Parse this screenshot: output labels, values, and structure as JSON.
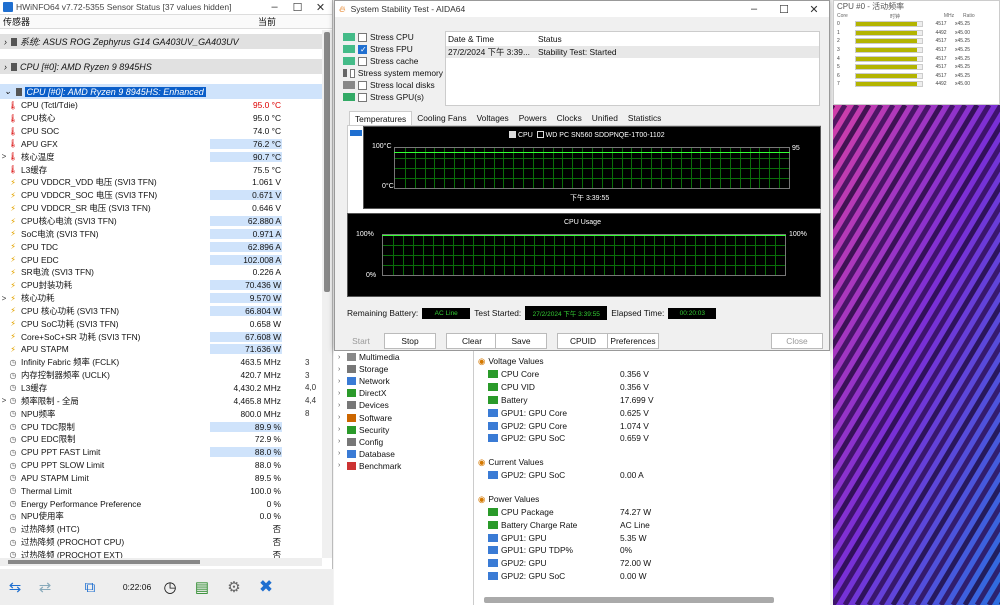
{
  "hwinfo": {
    "title": "HWiNFO64 v7.72-5355 Sensor Status [37 values hidden]",
    "col_sensor": "传感器",
    "col_current": "当前",
    "groups": [
      {
        "label": "系统: ASUS ROG Zephyrus G14 GA403UV_GA403UV"
      },
      {
        "label": "CPU [#0]: AMD Ryzen 9 8945HS"
      },
      {
        "label": "CPU [#0]: AMD Ryzen 9 8945HS: Enhanced"
      }
    ],
    "rows": [
      {
        "expand": "",
        "icon": "thermometer-icon",
        "label": "CPU (Tctl/Tdie)",
        "value": "95.0 °C",
        "hl": false,
        "red": true,
        "v2": ""
      },
      {
        "expand": "",
        "icon": "thermometer-icon",
        "label": "CPU核心",
        "value": "95.0 °C",
        "hl": false,
        "red": false,
        "v2": ""
      },
      {
        "expand": "",
        "icon": "thermometer-icon",
        "label": "CPU SOC",
        "value": "74.0 °C",
        "hl": false,
        "red": false,
        "v2": ""
      },
      {
        "expand": "",
        "icon": "thermometer-icon",
        "label": "APU GFX",
        "value": "76.2 °C",
        "hl": true,
        "red": false,
        "v2": ""
      },
      {
        "expand": ">",
        "icon": "thermometer-icon",
        "label": "核心温度",
        "value": "90.7 °C",
        "hl": true,
        "red": false,
        "v2": ""
      },
      {
        "expand": "",
        "icon": "thermometer-icon",
        "label": "L3缓存",
        "value": "75.5 °C",
        "hl": false,
        "red": false,
        "v2": ""
      },
      {
        "expand": "",
        "icon": "voltage-icon",
        "label": "CPU VDDCR_VDD 电压 (SVI3 TFN)",
        "value": "1.061 V",
        "hl": false,
        "red": false,
        "v2": ""
      },
      {
        "expand": "",
        "icon": "voltage-icon",
        "label": "CPU VDDCR_SOC 电压 (SVI3 TFN)",
        "value": "0.671 V",
        "hl": true,
        "red": false,
        "v2": ""
      },
      {
        "expand": "",
        "icon": "voltage-icon",
        "label": "CPU VDDCR_SR 电压 (SVI3 TFN)",
        "value": "0.646 V",
        "hl": false,
        "red": false,
        "v2": ""
      },
      {
        "expand": "",
        "icon": "current-icon",
        "label": "CPU核心电流 (SVI3 TFN)",
        "value": "62.880 A",
        "hl": true,
        "red": false,
        "v2": ""
      },
      {
        "expand": "",
        "icon": "current-icon",
        "label": "SoC电流 (SVI3 TFN)",
        "value": "0.971 A",
        "hl": true,
        "red": false,
        "v2": ""
      },
      {
        "expand": "",
        "icon": "current-icon",
        "label": "CPU TDC",
        "value": "62.896 A",
        "hl": true,
        "red": false,
        "v2": ""
      },
      {
        "expand": "",
        "icon": "current-icon",
        "label": "CPU EDC",
        "value": "102.008 A",
        "hl": true,
        "red": false,
        "v2": ""
      },
      {
        "expand": "",
        "icon": "current-icon",
        "label": "SR电流 (SVI3 TFN)",
        "value": "0.226 A",
        "hl": false,
        "red": false,
        "v2": ""
      },
      {
        "expand": "",
        "icon": "power-icon",
        "label": "CPU封装功耗",
        "value": "70.436 W",
        "hl": true,
        "red": false,
        "v2": ""
      },
      {
        "expand": ">",
        "icon": "power-icon",
        "label": "核心功耗",
        "value": "9.570 W",
        "hl": true,
        "red": false,
        "v2": ""
      },
      {
        "expand": "",
        "icon": "power-icon",
        "label": "CPU 核心功耗 (SVI3 TFN)",
        "value": "66.804 W",
        "hl": true,
        "red": false,
        "v2": ""
      },
      {
        "expand": "",
        "icon": "power-icon",
        "label": "CPU SoC功耗 (SVI3 TFN)",
        "value": "0.658 W",
        "hl": false,
        "red": false,
        "v2": ""
      },
      {
        "expand": "",
        "icon": "power-icon",
        "label": "Core+SoC+SR 功耗 (SVI3 TFN)",
        "value": "67.608 W",
        "hl": true,
        "red": false,
        "v2": ""
      },
      {
        "expand": "",
        "icon": "power-icon",
        "label": "APU STAPM",
        "value": "71.636 W",
        "hl": true,
        "red": false,
        "v2": ""
      },
      {
        "expand": "",
        "icon": "clock-icon",
        "label": "Infinity Fabric 频率 (FCLK)",
        "value": "463.5 MHz",
        "hl": false,
        "red": false,
        "v2": "3"
      },
      {
        "expand": "",
        "icon": "clock-icon",
        "label": "内存控制器频率 (UCLK)",
        "value": "420.7 MHz",
        "hl": false,
        "red": false,
        "v2": "3"
      },
      {
        "expand": "",
        "icon": "clock-icon",
        "label": "L3缓存",
        "value": "4,430.2 MHz",
        "hl": false,
        "red": false,
        "v2": "4,0"
      },
      {
        "expand": ">",
        "icon": "clock-icon",
        "label": "频率限制 - 全局",
        "value": "4,465.8 MHz",
        "hl": false,
        "red": false,
        "v2": "4,4"
      },
      {
        "expand": "",
        "icon": "clock-icon",
        "label": "NPU频率",
        "value": "800.0 MHz",
        "hl": false,
        "red": false,
        "v2": "8"
      },
      {
        "expand": "",
        "icon": "clock-icon",
        "label": "CPU TDC限制",
        "value": "89.9 %",
        "hl": true,
        "red": false,
        "v2": ""
      },
      {
        "expand": "",
        "icon": "clock-icon",
        "label": "CPU EDC限制",
        "value": "72.9 %",
        "hl": false,
        "red": false,
        "v2": ""
      },
      {
        "expand": "",
        "icon": "clock-icon",
        "label": "CPU PPT FAST Limit",
        "value": "88.0 %",
        "hl": true,
        "red": false,
        "v2": ""
      },
      {
        "expand": "",
        "icon": "clock-icon",
        "label": "CPU PPT SLOW Limit",
        "value": "88.0 %",
        "hl": false,
        "red": false,
        "v2": ""
      },
      {
        "expand": "",
        "icon": "clock-icon",
        "label": "APU STAPM Limit",
        "value": "89.5 %",
        "hl": false,
        "red": false,
        "v2": ""
      },
      {
        "expand": "",
        "icon": "clock-icon",
        "label": "Thermal Limit",
        "value": "100.0 %",
        "hl": false,
        "red": false,
        "v2": ""
      },
      {
        "expand": "",
        "icon": "clock-icon",
        "label": "Energy Performance Preference",
        "value": "0 %",
        "hl": false,
        "red": false,
        "v2": ""
      },
      {
        "expand": "",
        "icon": "clock-icon",
        "label": "NPU使用率",
        "value": "0.0 %",
        "hl": false,
        "red": false,
        "v2": ""
      },
      {
        "expand": "",
        "icon": "clock-icon",
        "label": "过热降频 (HTC)",
        "value": "否",
        "hl": false,
        "red": false,
        "v2": ""
      },
      {
        "expand": "",
        "icon": "clock-icon",
        "label": "过热降频 (PROCHOT CPU)",
        "value": "否",
        "hl": false,
        "red": false,
        "v2": ""
      },
      {
        "expand": "",
        "icon": "clock-icon",
        "label": "过热降频 (PROCHOT EXT)",
        "value": "否",
        "hl": false,
        "red": false,
        "v2": ""
      }
    ],
    "elapsed": "0:22:06"
  },
  "aida": {
    "title": "System Stability Test - AIDA64",
    "stress_items": [
      {
        "label": "Stress CPU",
        "checked": false,
        "icon": "cpu-chip-icon"
      },
      {
        "label": "Stress FPU",
        "checked": true,
        "icon": "fpu-chip-icon"
      },
      {
        "label": "Stress cache",
        "checked": false,
        "icon": "cache-chip-icon"
      },
      {
        "label": "Stress system memory",
        "checked": false,
        "icon": "memory-icon"
      },
      {
        "label": "Stress local disks",
        "checked": false,
        "icon": "disk-icon"
      },
      {
        "label": "Stress GPU(s)",
        "checked": false,
        "icon": "gpu-icon"
      }
    ],
    "log_headers": {
      "date": "Date & Time",
      "status": "Status"
    },
    "log_rows": [
      {
        "date": "27/2/2024 下午 3:39...",
        "status": "Stability Test: Started"
      }
    ],
    "tabs": [
      "Temperatures",
      "Cooling Fans",
      "Voltages",
      "Powers",
      "Clocks",
      "Unified",
      "Statistics"
    ],
    "temp_graph": {
      "legend_cpu": "CPU",
      "legend_disk": "WD PC SN560 SDDPNQE-1T00-1102",
      "y_top": "100°C",
      "y_bottom": "0°C",
      "value": "95",
      "time": "下午 3:39:55"
    },
    "cpu_graph": {
      "title": "CPU Usage",
      "y_top": "100%",
      "y_bottom": "0%",
      "value": "100%"
    },
    "status": {
      "remaining_label": "Remaining Battery:",
      "remaining_value": "AC Line",
      "started_label": "Test Started:",
      "started_value": "27/2/2024 下午 3:39:55",
      "elapsed_label": "Elapsed Time:",
      "elapsed_value": "00:20:03"
    },
    "buttons": {
      "start": "Start",
      "stop": "Stop",
      "clear": "Clear",
      "save": "Save",
      "cpuid": "CPUID",
      "prefs": "Preferences",
      "close": "Close"
    }
  },
  "aida_main": {
    "tree": [
      {
        "label": "Multimedia",
        "icon": "multimedia-icon"
      },
      {
        "label": "Storage",
        "icon": "storage-icon"
      },
      {
        "label": "Network",
        "icon": "network-icon"
      },
      {
        "label": "DirectX",
        "icon": "directx-icon"
      },
      {
        "label": "Devices",
        "icon": "devices-icon"
      },
      {
        "label": "Software",
        "icon": "software-icon"
      },
      {
        "label": "Security",
        "icon": "security-icon"
      },
      {
        "label": "Config",
        "icon": "config-icon"
      },
      {
        "label": "Database",
        "icon": "database-icon"
      },
      {
        "label": "Benchmark",
        "icon": "benchmark-icon"
      }
    ],
    "sections": [
      {
        "title": "Voltage Values",
        "rows": [
          {
            "label": "CPU Core",
            "value": "0.356 V",
            "icon": "cpu-icon"
          },
          {
            "label": "CPU VID",
            "value": "0.356 V",
            "icon": "cpu-icon"
          },
          {
            "label": "Battery",
            "value": "17.699 V",
            "icon": "battery-icon"
          },
          {
            "label": "GPU1: GPU Core",
            "value": "0.625 V",
            "icon": "gpu-icon"
          },
          {
            "label": "GPU2: GPU Core",
            "value": "1.074 V",
            "icon": "gpu-icon"
          },
          {
            "label": "GPU2: GPU SoC",
            "value": "0.659 V",
            "icon": "gpu-icon"
          }
        ]
      },
      {
        "title": "Current Values",
        "rows": [
          {
            "label": "GPU2: GPU SoC",
            "value": "0.00 A",
            "icon": "gpu-icon"
          }
        ]
      },
      {
        "title": "Power Values",
        "rows": [
          {
            "label": "CPU Package",
            "value": "74.27 W",
            "icon": "cpu-icon"
          },
          {
            "label": "Battery Charge Rate",
            "value": "AC Line",
            "icon": "battery-icon"
          },
          {
            "label": "GPU1: GPU",
            "value": "5.35 W",
            "icon": "gpu-icon"
          },
          {
            "label": "GPU1: GPU TDP%",
            "value": "0%",
            "icon": "gpu-icon"
          },
          {
            "label": "GPU2: GPU",
            "value": "72.00 W",
            "icon": "gpu-icon"
          },
          {
            "label": "GPU2: GPU SoC",
            "value": "0.00 W",
            "icon": "gpu-icon"
          }
        ]
      }
    ]
  },
  "cpu_monitor": {
    "title": "CPU #0 - 活动频率",
    "headers": {
      "core": "Core",
      "clock": "时钟",
      "mhz": "MHz",
      "ratio": "Ratio"
    },
    "cores": [
      {
        "id": "0",
        "load": 0.92,
        "mhz": "4517",
        "ratio": "x45.25"
      },
      {
        "id": "1",
        "load": 0.92,
        "mhz": "4492",
        "ratio": "x45.00"
      },
      {
        "id": "2",
        "load": 0.92,
        "mhz": "4517",
        "ratio": "x45.25"
      },
      {
        "id": "3",
        "load": 0.92,
        "mhz": "4517",
        "ratio": "x45.25"
      },
      {
        "id": "4",
        "load": 0.92,
        "mhz": "4517",
        "ratio": "x45.25"
      },
      {
        "id": "5",
        "load": 0.92,
        "mhz": "4517",
        "ratio": "x45.25"
      },
      {
        "id": "6",
        "load": 0.92,
        "mhz": "4517",
        "ratio": "x45.25"
      },
      {
        "id": "7",
        "load": 0.92,
        "mhz": "4492",
        "ratio": "x45.00"
      }
    ]
  },
  "colors": {
    "accent": "#1f6fd0",
    "highlight": "#cfe3fb",
    "graph_bg": "#000000",
    "grid": "#0a6e0a",
    "status_green": "#33cc33"
  }
}
